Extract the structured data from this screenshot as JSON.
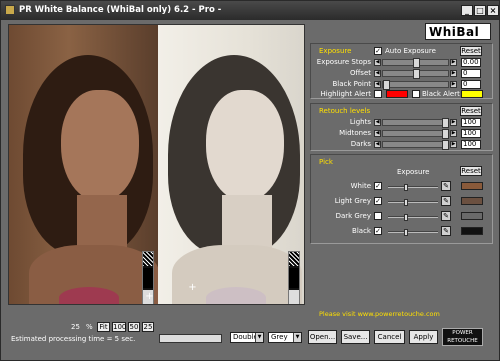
{
  "window": {
    "title": "PR White Balance (WhiBal only) 6.2 - Pro -",
    "min_label": "_",
    "max_label": "□",
    "close_label": "×"
  },
  "logo": {
    "text": "WhiBal"
  },
  "exposure": {
    "title": "Exposure",
    "auto_label": "Auto Exposure",
    "reset": "Reset",
    "stops_label": "Exposure Stops",
    "stops_value": "0.00",
    "offset_label": "Offset",
    "offset_value": "0",
    "black_label": "Black Point",
    "black_value": "0",
    "highlight_label": "Highlight Alert",
    "black_alert_label": "Black Alert",
    "highlight_color": "#ff0000",
    "black_alert_color": "#ffff00"
  },
  "retouch": {
    "title": "Retouch levels",
    "reset": "Reset",
    "lights_label": "Lights",
    "lights_value": "100",
    "midtones_label": "Midtones",
    "midtones_value": "100",
    "darks_label": "Darks",
    "darks_value": "100"
  },
  "pick": {
    "title": "Pick",
    "exposure_label": "Exposure",
    "reset": "Reset",
    "rows": [
      {
        "label": "White",
        "color": "#8a5a3a"
      },
      {
        "label": "Light Grey",
        "color": "#6b5040"
      },
      {
        "label": "Dark Grey",
        "color": "#6a6a6a"
      },
      {
        "label": "Black",
        "color": "#111111"
      }
    ]
  },
  "footer": {
    "visit": "Please visit www.powerretouche.com",
    "zoom_value": "25",
    "zoom_unit": "%",
    "fit": "Fit",
    "z100": "100",
    "z50": "50",
    "z25": "25",
    "processing": "Estimated processing time = 5 sec.",
    "mode": "Double",
    "view": "Grey",
    "open": "Open...",
    "save": "Save...",
    "cancel": "Cancel",
    "apply": "Apply",
    "power_line1": "POWER",
    "power_line2": "RETOUCHE"
  }
}
